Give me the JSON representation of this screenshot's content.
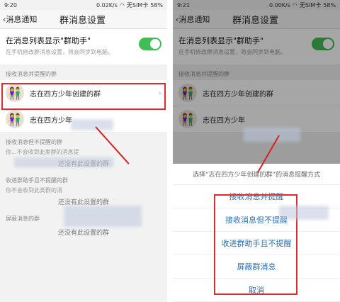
{
  "left": {
    "status": {
      "time": "9:20",
      "net": "0.02K/s",
      "carrier": "无SIM卡",
      "battery": "58%"
    },
    "nav": {
      "back": "消息通知",
      "title": "群消息设置"
    },
    "toggle_row": {
      "title": "在消息列表显示\"群助手\"",
      "subtitle": "在手机修改群消息设置，将会同步到电脑。"
    },
    "receive_header": "接收消息并提醒的群",
    "groups": [
      {
        "name": "志在四方少年创建的群"
      },
      {
        "name": "志在四方少年"
      }
    ],
    "no_remind_header": "接收消息但不提醒的群",
    "no_remind_sub": "你...不会收到此类群的消息提",
    "no_remind_empty": "还没有此设置的群",
    "helper_header": "收进群助手且不提醒的群",
    "helper_sub": "你不会收到此类群的消",
    "helper_empty": "还没有此设置的群",
    "block_header": "屏蔽消息的群",
    "block_empty": "还没有此设置的群"
  },
  "right": {
    "status": {
      "time": "9:21",
      "net": "0.00K/s",
      "carrier": "无SIM卡",
      "battery": "58%"
    },
    "nav": {
      "back": "消息通知",
      "title": "群消息设置"
    },
    "sheet_head": "选择“志在四方少年创建的群”的消息提醒方式",
    "options": [
      "接收消息并提醒",
      "接收消息但不提醒",
      "收进群助手且不提醒",
      "屏蔽群消息",
      "取消"
    ]
  },
  "colors": {
    "accent": "#3fbe55",
    "highlight": "#e32a2a",
    "link": "#2c6fb8"
  }
}
